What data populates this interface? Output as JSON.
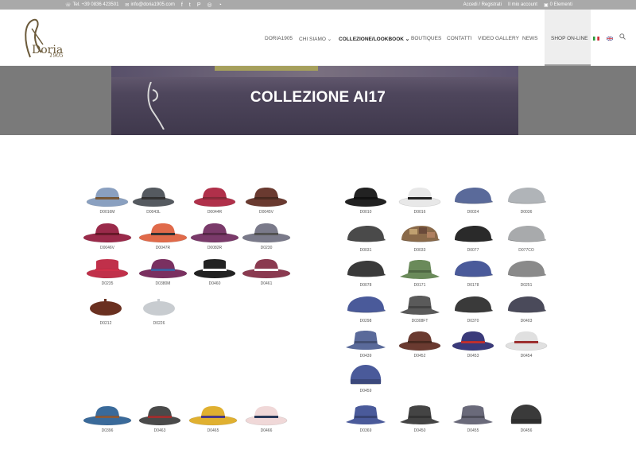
{
  "topbar": {
    "phone": "Tel. +39 0836 423501",
    "email": "info@doria1905.com",
    "login": "Accedi / Registrati",
    "account": "Il mio account",
    "cart": "0 Elementi"
  },
  "logo": {
    "name": "Doria",
    "year": "1905"
  },
  "nav": {
    "items": [
      "DORIA1905",
      "CHI SIAMO",
      "COLLEZIONE/LOOKBOOK",
      "BOUTIQUES",
      "CONTATTI",
      "VIDEO GALLERY",
      "NEWS"
    ],
    "shop": "SHOP ON-LINE"
  },
  "hero": {
    "title": "COLLEZIONE AI17"
  },
  "colors": {
    "topbar": "#a9a9a9",
    "hero_overlay": "#7a7a7a",
    "accent": "#6b5a3a"
  },
  "hats": [
    {
      "code": "D0016M",
      "style": "fedora",
      "color": "#8aa0c0",
      "band": "#7a5a3a"
    },
    {
      "code": "D0043L",
      "style": "fedora",
      "color": "#555a60",
      "band": "#333"
    },
    {
      "code": "D0044R",
      "style": "fedora",
      "color": "#b0304a",
      "band": "#8a2a3a"
    },
    {
      "code": "D0045V",
      "style": "fedora",
      "color": "#6a3a30",
      "band": "#4a2a20"
    },
    {
      "code": "D0046V",
      "style": "wide",
      "color": "#9a2a4a",
      "band": "#6a1a2a"
    },
    {
      "code": "D0047R",
      "style": "wide",
      "color": "#e06a4a",
      "band": "#333"
    },
    {
      "code": "D0082R",
      "style": "wide",
      "color": "#7a3a6a",
      "band": "#5a2a4a"
    },
    {
      "code": "D0230",
      "style": "wide",
      "color": "#7a7a8a",
      "band": "#555"
    },
    {
      "code": "D0235",
      "style": "boater",
      "color": "#c0304a",
      "band": "#d0304a"
    },
    {
      "code": "D0380M",
      "style": "wide",
      "color": "#7a3060",
      "band": "#4060a0"
    },
    {
      "code": "D0460",
      "style": "boater",
      "color": "#222",
      "band": "#fff"
    },
    {
      "code": "D0461",
      "style": "wide",
      "color": "#8a3a50",
      "band": "#fff"
    },
    {
      "code": "D0212",
      "style": "beret",
      "color": "#6a3020",
      "band": ""
    },
    {
      "code": "D0226",
      "style": "beret",
      "color": "#c8ccd0",
      "band": ""
    },
    {
      "code": "D0010",
      "style": "fedora",
      "color": "#222",
      "band": "#111"
    },
    {
      "code": "D0016",
      "style": "fedora",
      "color": "#e8e8e8",
      "band": "#222"
    },
    {
      "code": "D0024",
      "style": "cap",
      "color": "#5a6a9a",
      "band": ""
    },
    {
      "code": "D0036",
      "style": "cap",
      "color": "#b0b4b8",
      "band": ""
    },
    {
      "code": "D0031",
      "style": "cap",
      "color": "#4a4a4a",
      "band": ""
    },
    {
      "code": "D0033",
      "style": "patch",
      "color": "#8a6a4a",
      "band": ""
    },
    {
      "code": "D0077",
      "style": "cap",
      "color": "#2a2a2a",
      "band": ""
    },
    {
      "code": "D077CO",
      "style": "cap",
      "color": "#a8aaac",
      "band": ""
    },
    {
      "code": "D0078",
      "style": "cap",
      "color": "#3a3a3a",
      "band": ""
    },
    {
      "code": "D0171",
      "style": "bucket",
      "color": "#6a8a5a",
      "band": ""
    },
    {
      "code": "D0178",
      "style": "cap",
      "color": "#4a5a9a",
      "band": ""
    },
    {
      "code": "D0251",
      "style": "cap",
      "color": "#8a8a8a",
      "band": ""
    },
    {
      "code": "D0298",
      "style": "cap",
      "color": "#4a5a9a",
      "band": ""
    },
    {
      "code": "D0308FT",
      "style": "bucket",
      "color": "#5a5a5a",
      "band": ""
    },
    {
      "code": "D0370",
      "style": "cap",
      "color": "#3a3a3a",
      "band": ""
    },
    {
      "code": "D0403",
      "style": "cap",
      "color": "#4a4a5a",
      "band": ""
    },
    {
      "code": "D0439",
      "style": "bucket",
      "color": "#5a6a9a",
      "band": ""
    },
    {
      "code": "D0452",
      "style": "fedora",
      "color": "#6a3a30",
      "band": "#4a2a20"
    },
    {
      "code": "D0453",
      "style": "fedora",
      "color": "#3a3a7a",
      "band": "#c03030"
    },
    {
      "code": "D0454",
      "style": "fedora",
      "color": "#e0e0e0",
      "band": "#a03030"
    },
    {
      "code": "D0459",
      "style": "beanie",
      "color": "#4a5a9a",
      "band": ""
    },
    {
      "code": "D0396",
      "style": "wide",
      "color": "#3a6a9a",
      "band": "#8a5a3a"
    },
    {
      "code": "D0463",
      "style": "fedora",
      "color": "#4a4a4a",
      "band": "#a03030"
    },
    {
      "code": "D0465",
      "style": "wide",
      "color": "#e0b030",
      "band": "#4a3a8a"
    },
    {
      "code": "D0466",
      "style": "fedora",
      "color": "#f0d8d8",
      "band": "#2a3a5a"
    },
    {
      "code": "D0369",
      "style": "bucket",
      "color": "#4a5a9a",
      "band": ""
    },
    {
      "code": "D0450",
      "style": "bucket",
      "color": "#444",
      "band": ""
    },
    {
      "code": "D0455",
      "style": "bucket",
      "color": "#6a6a7a",
      "band": ""
    },
    {
      "code": "D0456",
      "style": "beanie",
      "color": "#3a3a3a",
      "band": ""
    }
  ]
}
